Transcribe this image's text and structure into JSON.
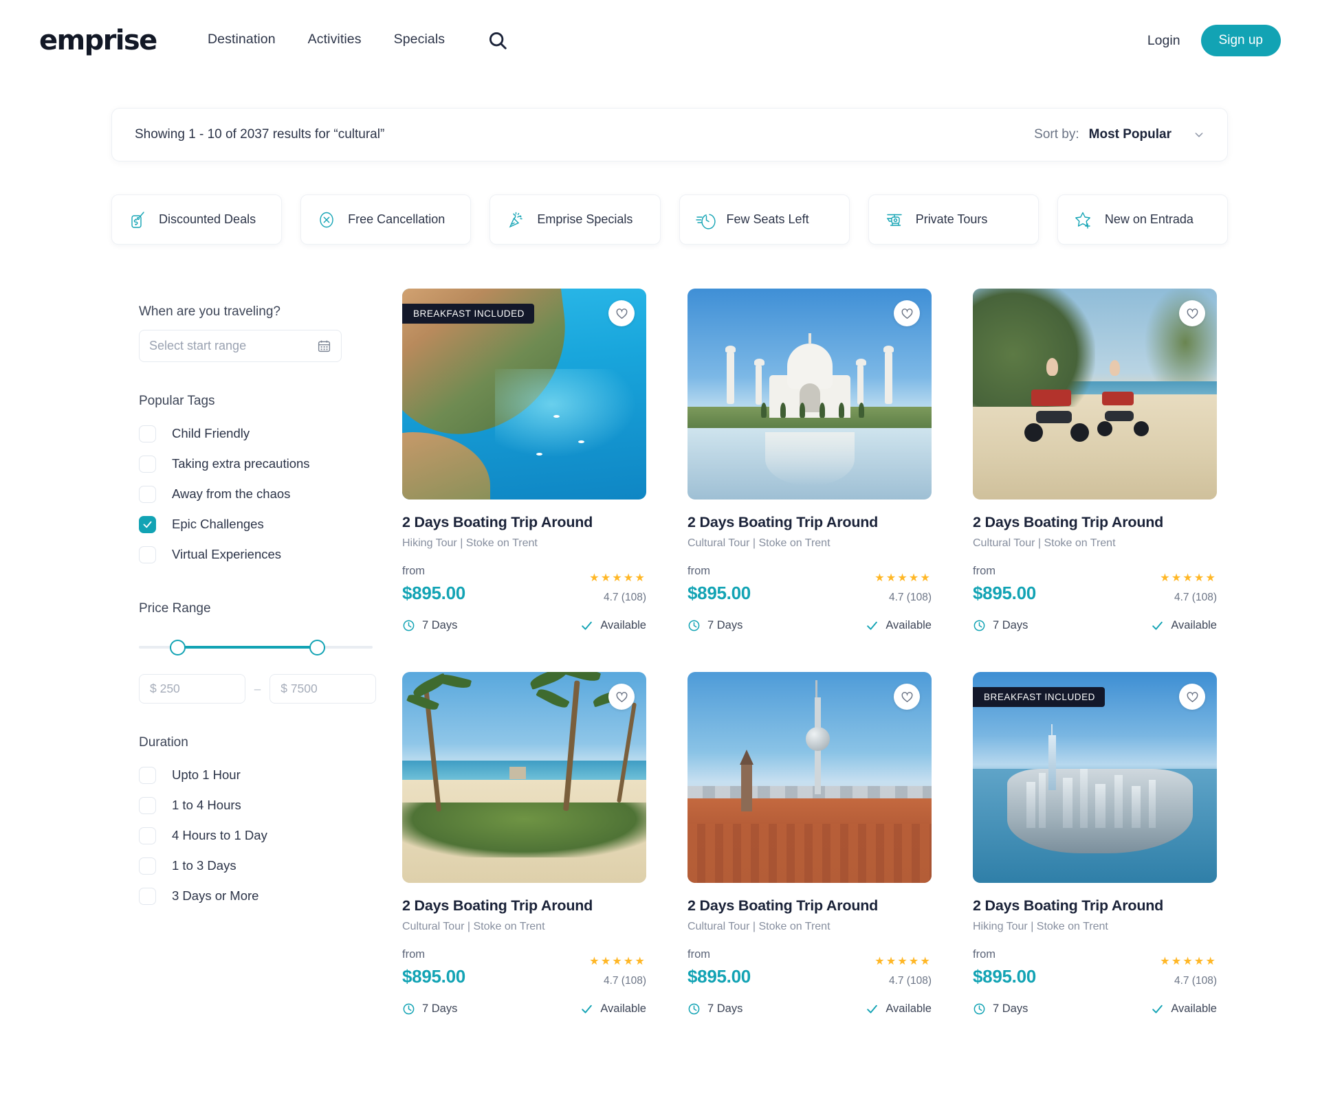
{
  "header": {
    "logo": "emprise",
    "nav": [
      {
        "label": "Destination"
      },
      {
        "label": "Activities"
      },
      {
        "label": "Specials"
      }
    ],
    "search_icon": "search-icon",
    "login_label": "Login",
    "signup_label": "Sign up"
  },
  "results_bar": {
    "results_text": "Showing 1 - 10 of 2037 results for “cultural”",
    "sort_label": "Sort by:",
    "sort_value": "Most Popular"
  },
  "filter_chips": [
    {
      "label": "Discounted Deals",
      "icon": "price-tag-icon"
    },
    {
      "label": "Free Cancellation",
      "icon": "x-circle-icon"
    },
    {
      "label": "Emprise Specials",
      "icon": "party-popper-icon"
    },
    {
      "label": "Few Seats Left",
      "icon": "fast-clock-icon"
    },
    {
      "label": "Private Tours",
      "icon": "helicopter-icon"
    },
    {
      "label": "New on Entrada",
      "icon": "star-plus-icon"
    }
  ],
  "sidebar": {
    "date": {
      "title": "When are you traveling?",
      "placeholder": "Select start range",
      "icon": "calendar-icon"
    },
    "popular_tags": {
      "title": "Popular Tags",
      "items": [
        {
          "label": "Child Friendly",
          "checked": false
        },
        {
          "label": "Taking extra precautions",
          "checked": false
        },
        {
          "label": "Away from the chaos",
          "checked": false
        },
        {
          "label": "Epic Challenges",
          "checked": true
        },
        {
          "label": "Virtual Experiences",
          "checked": false
        }
      ]
    },
    "price_range": {
      "title": "Price Range",
      "min_placeholder": "$ 250",
      "max_placeholder": "$ 7500",
      "separator": "–"
    },
    "duration": {
      "title": "Duration",
      "items": [
        {
          "label": "Upto 1 Hour",
          "checked": false
        },
        {
          "label": "1 to 4 Hours",
          "checked": false
        },
        {
          "label": "4 Hours to 1 Day",
          "checked": false
        },
        {
          "label": "1 to 3 Days",
          "checked": false
        },
        {
          "label": "3 Days or More",
          "checked": false
        }
      ]
    }
  },
  "cards": [
    {
      "badge": "BREAKFAST INCLUDED",
      "title": "2 Days Boating Trip Around",
      "subtitle": "Hiking Tour | Stoke on Trent",
      "from_label": "from",
      "price": "$895.00",
      "stars": "★★★★★",
      "rating": "4.7 (108)",
      "duration": "7 Days",
      "availability": "Available",
      "scene": "coastal-bay"
    },
    {
      "badge": "",
      "title": "2 Days Boating Trip Around",
      "subtitle": "Cultural Tour | Stoke on Trent",
      "from_label": "from",
      "price": "$895.00",
      "stars": "★★★★★",
      "rating": "4.7 (108)",
      "duration": "7 Days",
      "availability": "Available",
      "scene": "taj-mahal"
    },
    {
      "badge": "",
      "title": "2 Days Boating Trip Around",
      "subtitle": "Cultural Tour | Stoke on Trent",
      "from_label": "from",
      "price": "$895.00",
      "stars": "★★★★★",
      "rating": "4.7 (108)",
      "duration": "7 Days",
      "availability": "Available",
      "scene": "quad-bike-beach"
    },
    {
      "badge": "",
      "title": "2 Days Boating Trip Around",
      "subtitle": "Cultural Tour | Stoke on Trent",
      "from_label": "from",
      "price": "$895.00",
      "stars": "★★★★★",
      "rating": "4.7 (108)",
      "duration": "7 Days",
      "availability": "Available",
      "scene": "palm-beach"
    },
    {
      "badge": "",
      "title": "2 Days Boating Trip Around",
      "subtitle": "Cultural Tour | Stoke on Trent",
      "from_label": "from",
      "price": "$895.00",
      "stars": "★★★★★",
      "rating": "4.7 (108)",
      "duration": "7 Days",
      "availability": "Available",
      "scene": "european-city"
    },
    {
      "badge": "BREAKFAST INCLUDED",
      "title": "2 Days Boating Trip Around",
      "subtitle": "Hiking Tour | Stoke on Trent",
      "from_label": "from",
      "price": "$895.00",
      "stars": "★★★★★",
      "rating": "4.7 (108)",
      "duration": "7 Days",
      "availability": "Available",
      "scene": "nyc-skyline"
    }
  ],
  "colors": {
    "accent_teal": "#12a3b4",
    "text_dark": "#1a2238",
    "text_muted": "#868e9e",
    "star_gold": "#ffb726",
    "badge_bg": "#13182a"
  }
}
